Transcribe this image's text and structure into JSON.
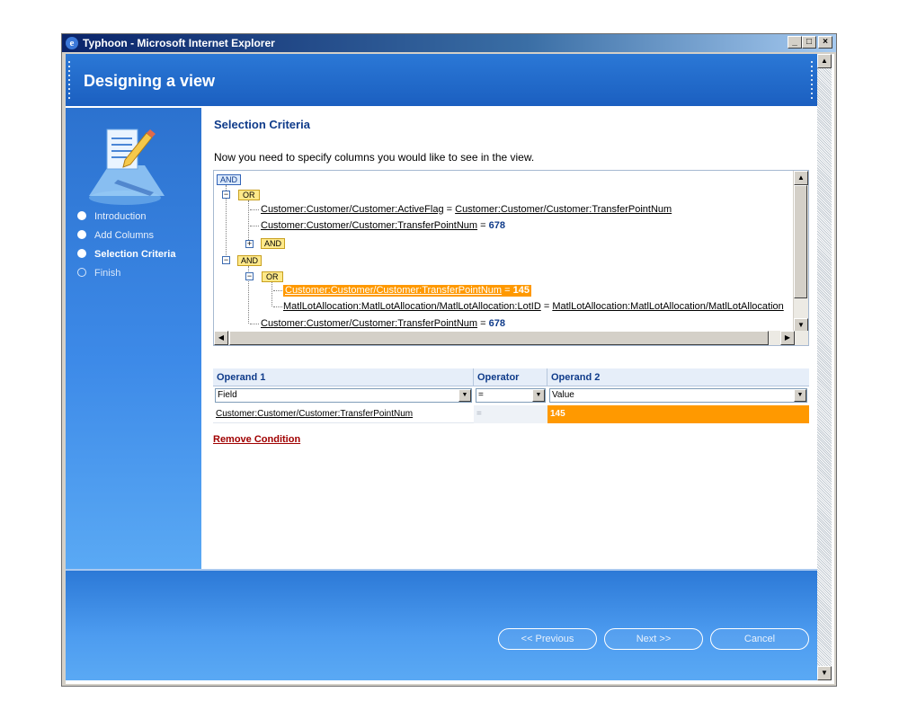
{
  "window": {
    "title": "Typhoon - Microsoft Internet Explorer",
    "controls": {
      "minimize": "_",
      "maximize": "□",
      "close": "×"
    }
  },
  "header": {
    "title": "Designing a view"
  },
  "sidebar": {
    "steps": [
      {
        "label": "Introduction",
        "state": "done"
      },
      {
        "label": "Add Columns",
        "state": "done"
      },
      {
        "label": "Selection Criteria",
        "state": "current"
      },
      {
        "label": "Finish",
        "state": "pending"
      }
    ]
  },
  "main": {
    "section_title": "Selection Criteria",
    "instructions": "Now you need to specify columns you would like to see in the view.",
    "tree": {
      "root": "AND",
      "or1": "OR",
      "cond1": {
        "left": "Customer:Customer/Customer:ActiveFlag",
        "op": "=",
        "right": "Customer:Customer/Customer:TransferPointNum"
      },
      "cond2": {
        "left": "Customer:Customer/Customer:TransferPointNum",
        "op": "=",
        "value": "678"
      },
      "and_collapsed": "AND",
      "and2": "AND",
      "or2": "OR",
      "cond3": {
        "left": "Customer:Customer/Customer:TransferPointNum",
        "op": "=",
        "value": "145"
      },
      "cond4": {
        "left": "MatlLotAllocation:MatlLotAllocation/MatlLotAllocation:LotID",
        "op": "=",
        "right": "MatlLotAllocation:MatlLotAllocation/MatlLotAllocation"
      },
      "cond5": {
        "left": "Customer:Customer/Customer:TransferPointNum",
        "op": "=",
        "value": "678"
      }
    },
    "grid": {
      "headers": {
        "operand1": "Operand 1",
        "operator": "Operator",
        "operand2": "Operand 2"
      },
      "selects": {
        "operand1": "Field",
        "operator": "=",
        "operand2": "Value"
      },
      "row": {
        "operand1": "Customer:Customer/Customer:TransferPointNum",
        "operator": "=",
        "operand2": "145"
      }
    },
    "remove_condition": "Remove Condition"
  },
  "footer": {
    "previous": "<< Previous",
    "next": "Next >>",
    "cancel": "Cancel"
  },
  "colors": {
    "accent_blue": "#2b78d6",
    "title_navy": "#0f3b8a",
    "highlight_orange": "#ff9900",
    "remove_red": "#a00000"
  }
}
